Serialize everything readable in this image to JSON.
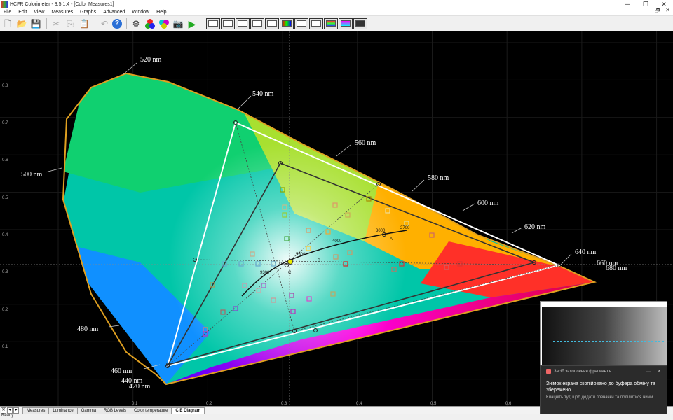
{
  "window": {
    "title": "HCFR Colorimeter - 3.5.1.4 - [Color Measures1]",
    "controls": {
      "minimize": "─",
      "restore": "❐",
      "close": "✕"
    },
    "mdi_controls": {
      "minimize": "_",
      "restore": "🗗",
      "close": "✕"
    }
  },
  "menu": [
    "File",
    "Edit",
    "View",
    "Measures",
    "Graphs",
    "Advanced",
    "Window",
    "Help"
  ],
  "toolbar": {
    "buttons": [
      "new-icon",
      "open-icon",
      "save-icon",
      "cut-icon",
      "copy-icon",
      "paste-icon",
      "undo-icon",
      "help-icon",
      "sensor-icon",
      "colors-icon",
      "palette-icon",
      "camera-icon",
      "play-icon",
      "monitor-icon"
    ]
  },
  "diagram": {
    "wavelength_labels": [
      "520 nm",
      "540 nm",
      "560 nm",
      "580 nm",
      "600 nm",
      "620 nm",
      "640 nm",
      "660 nm",
      "680 nm",
      "500 nm",
      "480 nm",
      "460 nm",
      "440 nm",
      "420 nm"
    ],
    "cct_labels": [
      "3000",
      "2700",
      "4000",
      "5500",
      "9300"
    ],
    "illuminant_labels": [
      "A",
      "B",
      "C",
      "D65"
    ],
    "x_ticks": [
      "0.1",
      "0.2",
      "0.3",
      "0.4",
      "0.5",
      "0.6"
    ],
    "y_ticks": [
      "0.1",
      "0.2",
      "0.3",
      "0.4",
      "0.5",
      "0.6",
      "0.7",
      "0.8"
    ],
    "colors": {
      "locus_edge": "#e0a020",
      "gamut_target": "#ffffff",
      "gamut_measured": "#222222"
    }
  },
  "tabs": [
    "Measures",
    "Luminance",
    "Gamma",
    "RGB Levels",
    "Color temperature",
    "CIE Diagram"
  ],
  "active_tab": "CIE Diagram",
  "status": "Ready",
  "notification": {
    "app": "Засіб захоплення фрагментів",
    "more": "···",
    "close": "✕",
    "message": "Знімок екрана скопійовано до буфера обміну та збережено",
    "sub": "Клацніть тут, щоб додати позначки та поділитися ними."
  }
}
